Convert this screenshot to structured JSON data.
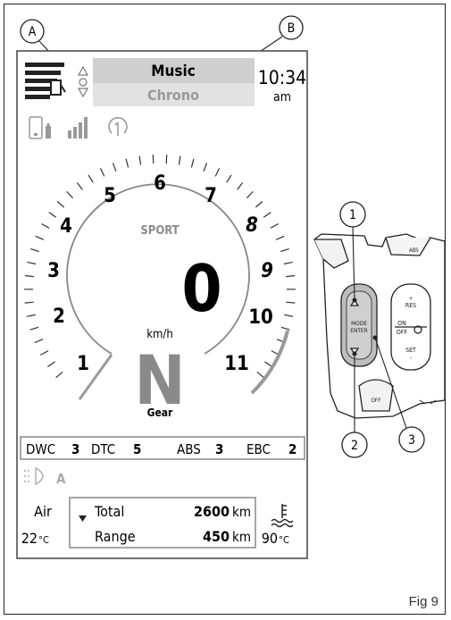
{
  "callouts": {
    "a": "A",
    "b": "B",
    "c1": "1",
    "c2": "2",
    "c3": "3"
  },
  "menu": {
    "active": "Music",
    "inactive": "Chrono"
  },
  "clock": {
    "time": "10:34",
    "ampm": "am"
  },
  "gear_ring": {
    "numbers": [
      "1",
      "2",
      "3",
      "4",
      "5",
      "6",
      "7",
      "8",
      "9",
      "10",
      "11"
    ]
  },
  "mode": "SPORT",
  "speed": {
    "value": "0",
    "unit": "km/h"
  },
  "gear": {
    "value": "N",
    "label": "Gear"
  },
  "assist": [
    {
      "name": "DWC",
      "value": "3"
    },
    {
      "name": "DTC",
      "value": "5"
    },
    {
      "name": "ABS",
      "value": "3"
    },
    {
      "name": "EBC",
      "value": "2"
    }
  ],
  "headlight": {
    "mode": "A"
  },
  "air": {
    "label": "Air",
    "value": "22",
    "unit": "°C"
  },
  "trip": {
    "row1": {
      "label": "Total",
      "value": "2600",
      "unit": "km"
    },
    "row2": {
      "label": "Range",
      "value": "450",
      "unit": "km"
    }
  },
  "coolant": {
    "value": "90",
    "unit": "°C"
  },
  "switch": {
    "mode": "MODE",
    "enter": "ENTER",
    "res": "RES",
    "set": "SET",
    "on": "ON",
    "off": "OFF",
    "off2": "OFF",
    "abs": "ABS"
  },
  "figure_label": "Fig 9",
  "colors": {
    "outline": "#222222",
    "grey": "#999999",
    "menu_bg": "#d0d0d0",
    "accent_grey": "#8a8a8a"
  }
}
